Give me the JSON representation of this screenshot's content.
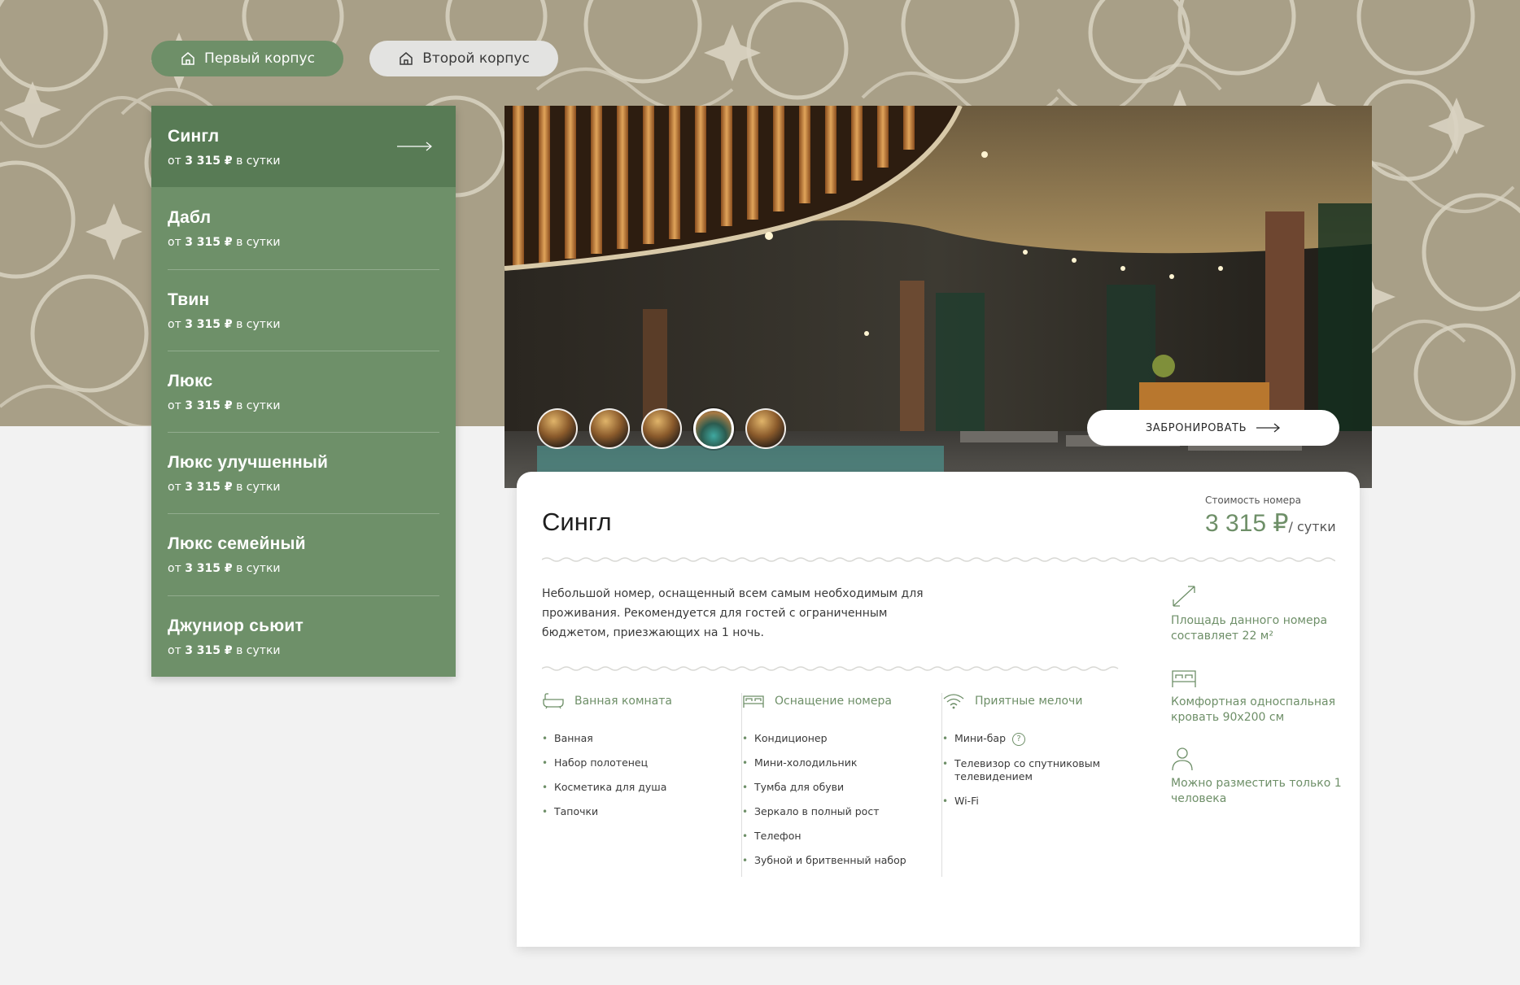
{
  "tabs": [
    {
      "label": "Первый корпус",
      "active": true
    },
    {
      "label": "Второй корпус",
      "active": false
    }
  ],
  "rooms": [
    {
      "name": "Сингл",
      "price_prefix": "от",
      "price": "3 315 ₽",
      "price_suffix": "в сутки",
      "active": true
    },
    {
      "name": "Дабл",
      "price_prefix": "от",
      "price": "3 315 ₽",
      "price_suffix": "в сутки"
    },
    {
      "name": "Твин",
      "price_prefix": "от",
      "price": "3 315 ₽",
      "price_suffix": "в сутки"
    },
    {
      "name": "Люкс",
      "price_prefix": "от",
      "price": "3 315 ₽",
      "price_suffix": "в сутки"
    },
    {
      "name": "Люкс улучшенный",
      "price_prefix": "от",
      "price": "3 315 ₽",
      "price_suffix": "в сутки"
    },
    {
      "name": "Люкс семейный",
      "price_prefix": "от",
      "price": "3 315 ₽",
      "price_suffix": "в сутки"
    },
    {
      "name": "Джуниор сьюит",
      "price_prefix": "от",
      "price": "3 315 ₽",
      "price_suffix": "в сутки"
    }
  ],
  "gallery": {
    "thumb_count": 5,
    "active_thumb": 4,
    "book_label": "ЗАБРОНИРОВАТЬ"
  },
  "card": {
    "title": "Сингл",
    "price_label": "Стоимость номера",
    "price_value": "3 315 ₽",
    "price_per": "/ сутки",
    "description": "Небольшой номер, оснащенный всем самым необходимым для проживания. Рекомендуется для гостей с ограниченным бюджетом, приезжающих на 1 ночь."
  },
  "amenities": [
    {
      "title": "Ванная комната",
      "icon": "bathtub-icon",
      "items": [
        "Ванная",
        "Набор полотенец",
        "Косметика для душа",
        "Тапочки"
      ]
    },
    {
      "title": "Оснащение номера",
      "icon": "bed-icon",
      "items": [
        "Кондиционер",
        "Мини-холодильник",
        "Тумба для обуви",
        "Зеркало в полный рост",
        "Телефон",
        "Зубной и бритвенный набор"
      ]
    },
    {
      "title": "Приятные мелочи",
      "icon": "wifi-icon",
      "items": [
        "Мини-бар",
        "Телевизор со спутниковым телевидением",
        "Wi-Fi"
      ]
    }
  ],
  "features": [
    {
      "icon": "area-expand-icon",
      "text": "Площадь данного номера составляет 22 м²"
    },
    {
      "icon": "bed-icon",
      "text": "Комфортная односпальная кровать 90x200 см"
    },
    {
      "icon": "person-icon",
      "text": "Можно разместить только 1 человека"
    }
  ],
  "colors": {
    "accent": "#6e8f68",
    "accent_dark": "#587b55",
    "pattern_bg": "#a89f87",
    "page_bg": "#f2f2f2"
  }
}
